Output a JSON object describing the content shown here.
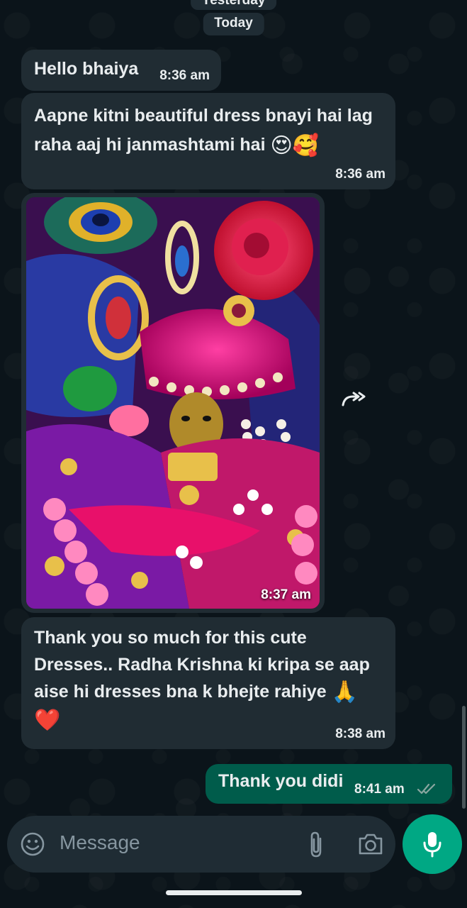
{
  "chat": {
    "date_chips": [
      "Yesterday",
      "Today"
    ],
    "messages": [
      {
        "direction": "incoming",
        "text": "Hello bhaiya",
        "time": "8:36 am"
      },
      {
        "direction": "incoming",
        "text": "Aapne kitni beautiful dress bnayi hai lag raha aaj hi janmashtami hai",
        "emojis": "😍🥰",
        "time": "8:36 am"
      },
      {
        "direction": "incoming",
        "type": "image",
        "image_alt": "Decorated idol in pink turban with peacock feather, jewels and flower garland",
        "time": "8:37 am"
      },
      {
        "direction": "incoming",
        "text": "Thank you so much for this cute Dresses.. Radha Krishna ki kripa se aap aise hi dresses bna k bhejte rahiye",
        "emojis": "🙏",
        "emoji_line2": "❤️",
        "time": "8:38 am"
      },
      {
        "direction": "outgoing",
        "text": "Thank you didi",
        "time": "8:41 am",
        "status": "read"
      }
    ]
  },
  "composer": {
    "placeholder": "Message"
  },
  "icons": {
    "emoji": "emoji-icon",
    "attach": "paperclip-icon",
    "camera": "camera-icon",
    "mic": "mic-icon",
    "forward": "forward-icon",
    "ticks": "double-check-icon"
  },
  "colors": {
    "background": "#0b141a",
    "incoming_bubble": "#202c33",
    "outgoing_bubble": "#005c4b",
    "accent": "#00a884"
  }
}
